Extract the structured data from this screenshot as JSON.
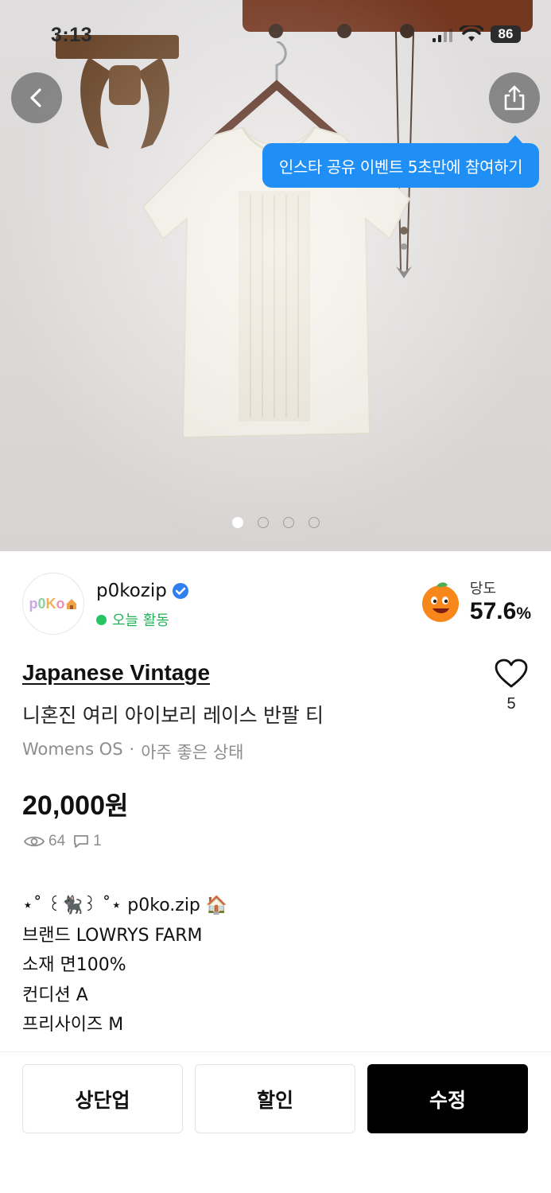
{
  "status_bar": {
    "time": "3:13",
    "battery": "86"
  },
  "photo": {
    "tooltip": "인스타 공유 이벤트 5초만에 참여하기",
    "page_indicator": {
      "total": 4,
      "current": 1
    }
  },
  "seller": {
    "avatar_text": [
      "p",
      "0",
      "K",
      "o"
    ],
    "name": "p0kozip",
    "activity": "오늘 활동",
    "sweetness_label": "당도",
    "sweetness_value": "57.6",
    "sweetness_unit": "%"
  },
  "product": {
    "brand": "Japanese Vintage",
    "title": "니혼진 여리 아이보리 레이스 반팔 티",
    "category": "Womens OS",
    "separator": "·",
    "condition": "아주 좋은 상태",
    "price": "20,000",
    "currency": "원",
    "likes": "5",
    "views": "64",
    "comments": "1"
  },
  "description": {
    "line1_prefix": "⋆˚ ꒰🐈‍⬛꒱ ˚⋆ p0ko.zip ",
    "line1_icon": "🏠",
    "line2": "브랜드 LOWRYS FARM",
    "line3": "소재 면100%",
    "line4": "컨디션 A",
    "line5": "",
    "line6": "프리사이즈 M"
  },
  "actions": {
    "bump": "상단업",
    "discount": "할인",
    "edit": "수정"
  },
  "colors": {
    "tooltip": "#1f8ff5",
    "active_green": "#27c464",
    "verified_blue": "#2f7ff0",
    "primary_button": "#000000"
  }
}
